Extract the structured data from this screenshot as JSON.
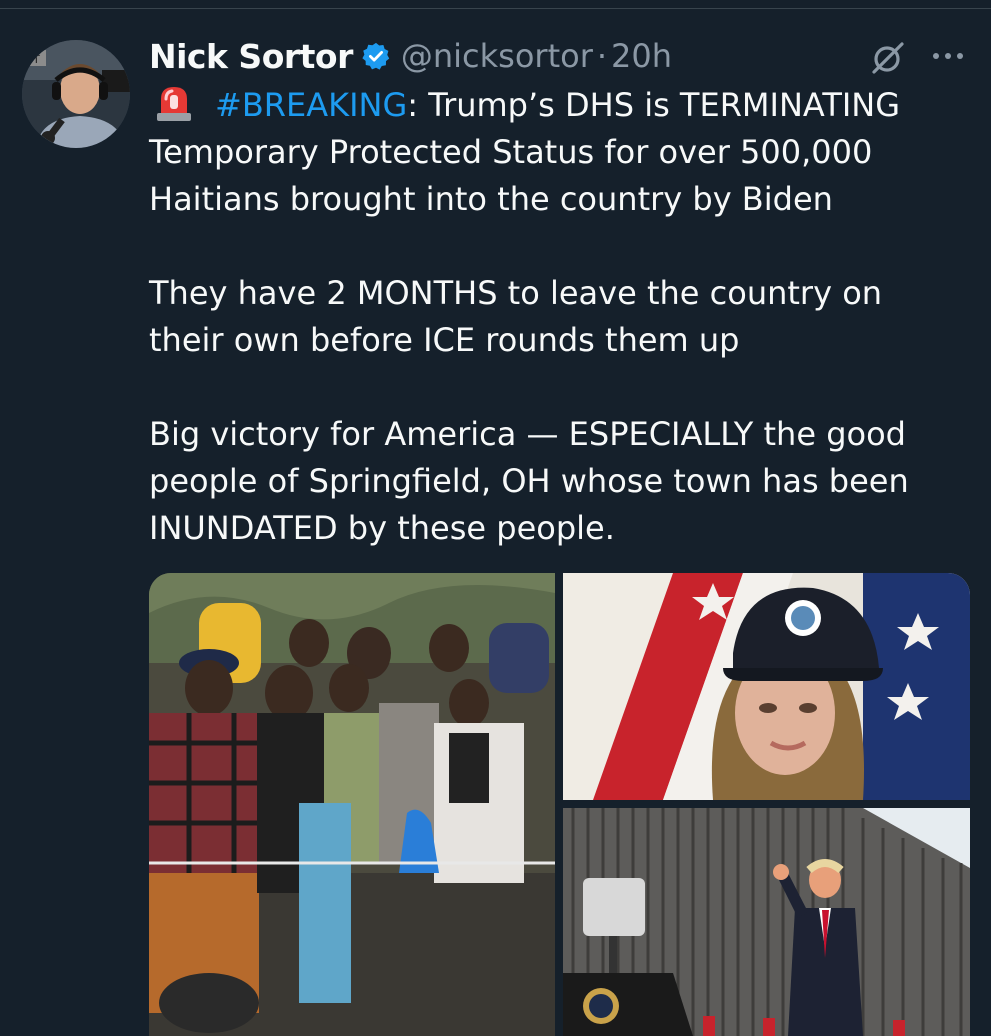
{
  "tweet": {
    "display_name": "Nick Sortor",
    "handle": "@nicksortor",
    "separator": "·",
    "time": "20h",
    "hashtag": "#BREAKING",
    "line1_rest": ": Trump’s DHS is TERMINATING",
    "line2": "Temporary Protected Status for over 500,000",
    "line3": "Haitians brought into the country by Biden",
    "line4": "They have 2 MONTHS to leave the country on",
    "line5": "their own before ICE rounds them up",
    "line6": "Big victory for America — ESPECIALLY the good",
    "line7": "people of Springfield, OH whose town has been",
    "line8": "INUNDATED by these people."
  },
  "icons": {
    "verified": "verified-badge-icon",
    "grok": "grok-icon",
    "more": "more-options-icon",
    "siren": "siren-emoji-icon"
  },
  "colors": {
    "background": "#15202b",
    "link": "#1d9bf0",
    "text": "#f7f9f9",
    "secondary": "#8b98a5"
  },
  "media": {
    "count": 3
  }
}
